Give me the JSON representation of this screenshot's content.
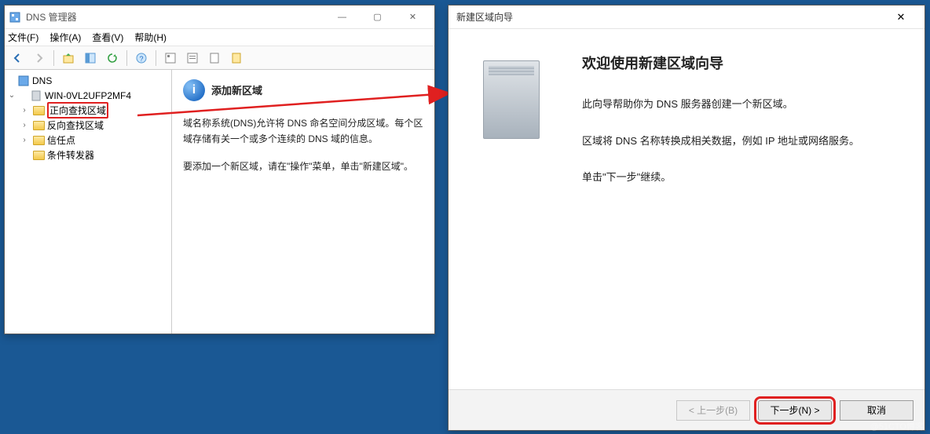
{
  "dns_window": {
    "title": "DNS 管理器",
    "menu": {
      "file": "文件(F)",
      "action": "操作(A)",
      "view": "查看(V)",
      "help": "帮助(H)"
    },
    "tree": {
      "root": "DNS",
      "server": "WIN-0VL2UFP2MF4",
      "nodes": [
        "正向查找区域",
        "反向查找区域",
        "信任点",
        "条件转发器"
      ]
    },
    "content": {
      "heading": "添加新区域",
      "para1": "域名称系统(DNS)允许将 DNS 命名空间分成区域。每个区域存储有关一个或多个连续的 DNS 域的信息。",
      "para2": "要添加一个新区域，请在\"操作\"菜单，单击\"新建区域\"。"
    }
  },
  "wizard": {
    "title": "新建区域向导",
    "heading": "欢迎使用新建区域向导",
    "p1": "此向导帮助你为 DNS 服务器创建一个新区域。",
    "p2": "区域将 DNS 名称转换成相关数据，例如 IP 地址或网络服务。",
    "p3": "单击\"下一步\"继续。",
    "buttons": {
      "back": "< 上一步(B)",
      "next": "下一步(N) >",
      "cancel": "取消"
    }
  },
  "watermark": "@51CTO博客"
}
